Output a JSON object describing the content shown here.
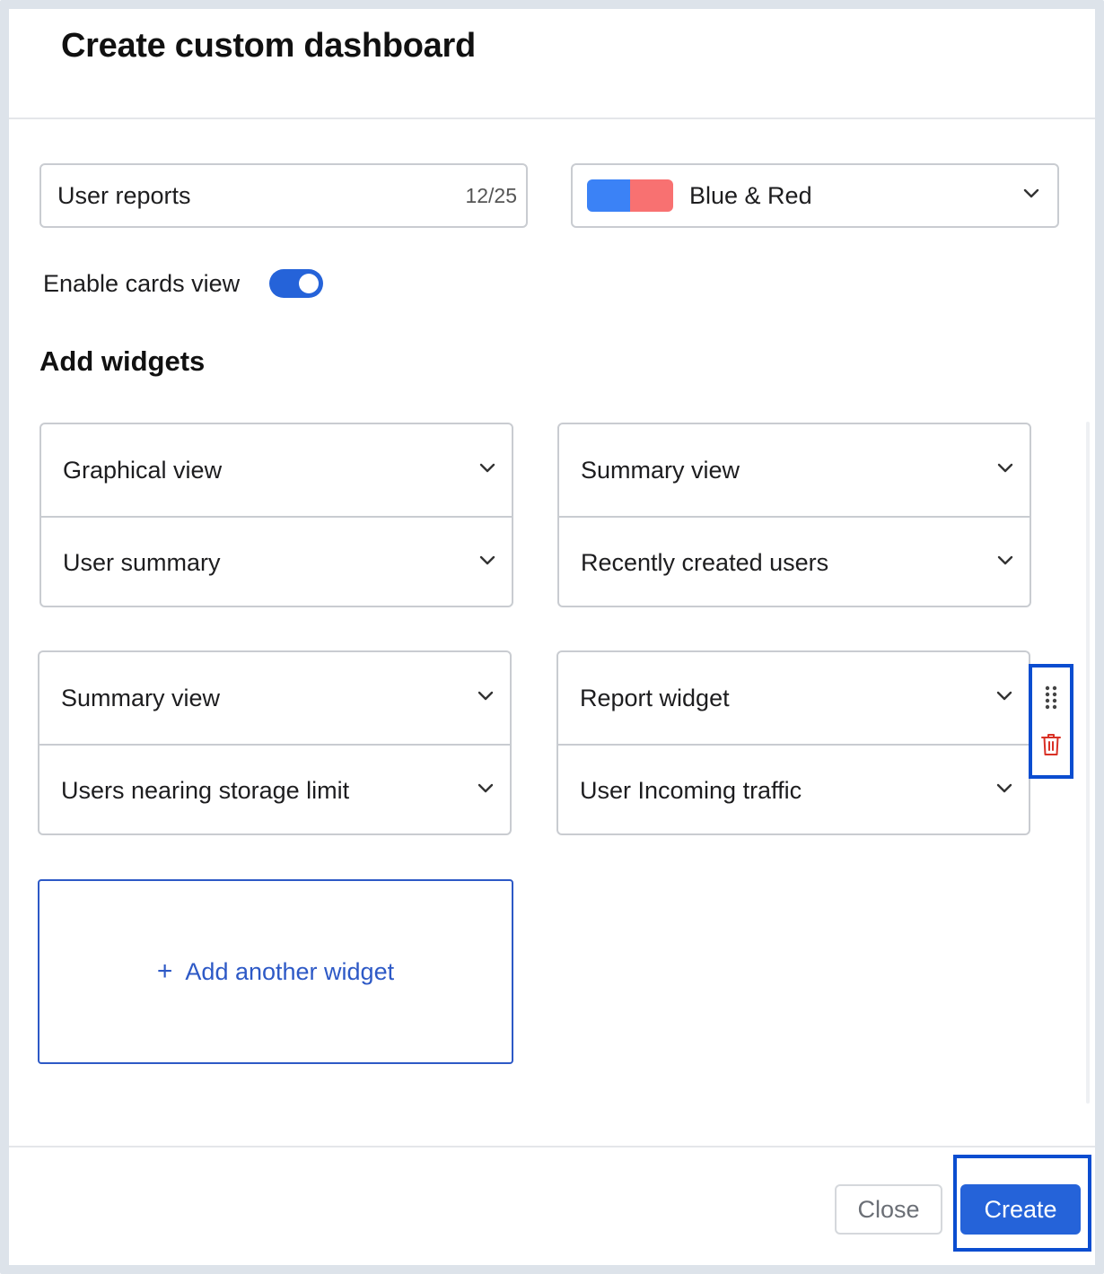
{
  "modal": {
    "title": "Create custom dashboard"
  },
  "name_field": {
    "value": "User reports",
    "char_count": "12/25"
  },
  "theme_select": {
    "label": "Blue & Red",
    "colors": [
      "#3b82f6",
      "#f87171"
    ],
    "icon": "chevron-down-icon"
  },
  "cards_view": {
    "label": "Enable cards view",
    "enabled": true,
    "on_color": "#2563d9"
  },
  "widgets_section": {
    "title": "Add widgets",
    "widgets": [
      {
        "type": "Graphical view",
        "item": "User summary"
      },
      {
        "type": "Summary view",
        "item": "Recently created users"
      },
      {
        "type": "Summary view",
        "item": "Users nearing storage limit"
      },
      {
        "type": "Report widget",
        "item": "User Incoming traffic"
      }
    ],
    "add_label": "Add another widget",
    "add_icon": "+",
    "accent": "#2d59c6",
    "row_actions": [
      "drag-handle-icon",
      "trash-icon"
    ],
    "trash_color": "#d93025"
  },
  "footer": {
    "close_label": "Close",
    "create_label": "Create",
    "primary_color": "#2563d9",
    "highlight_color": "#0b4dd0"
  }
}
